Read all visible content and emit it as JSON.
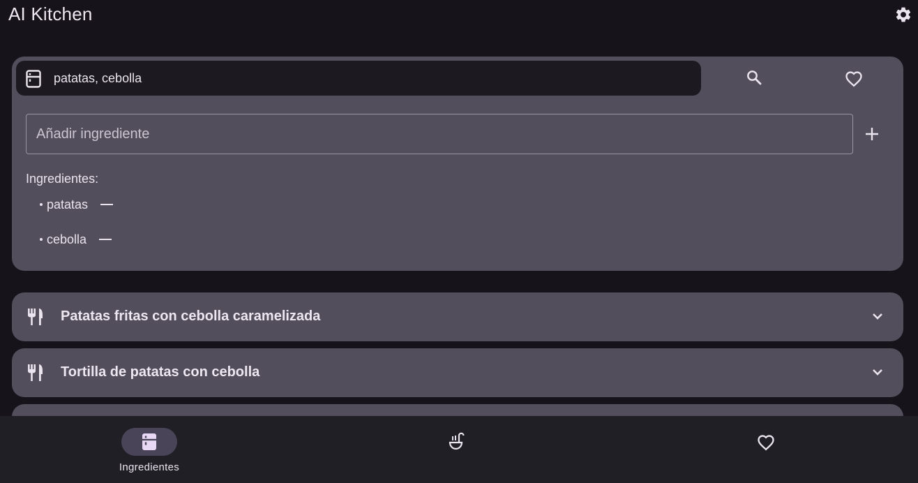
{
  "app": {
    "title": "AI Kitchen"
  },
  "search": {
    "query": "patatas, cebolla"
  },
  "ingredient_input": {
    "value": "",
    "placeholder": "Añadir ingrediente"
  },
  "ingredients": {
    "heading": "Ingredientes:",
    "items": [
      "patatas",
      "cebolla"
    ]
  },
  "recipes": [
    {
      "title": "Patatas fritas con cebolla caramelizada"
    },
    {
      "title": "Tortilla de patatas con cebolla"
    },
    {
      "title": ""
    }
  ],
  "nav": {
    "items": [
      {
        "label": "Ingredientes",
        "icon": "fridge-icon",
        "active": true
      },
      {
        "label": "",
        "icon": "soup-ladle-icon",
        "active": false
      },
      {
        "label": "",
        "icon": "heart-outline-icon",
        "active": false
      }
    ]
  },
  "colors": {
    "background": "#16141a",
    "card": "#524e5b",
    "search_bar": "#1c1a20",
    "nav_bar": "#211f26",
    "nav_active_pill": "#4a4458",
    "text": "#e9e4ee"
  }
}
